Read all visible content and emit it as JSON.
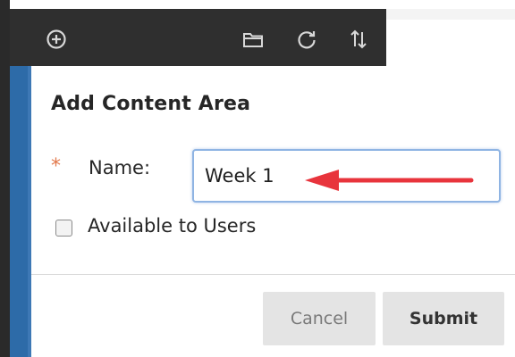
{
  "toolbar": {
    "icons": [
      "add-circle-icon",
      "folder-icon",
      "refresh-icon",
      "sort-icon"
    ]
  },
  "dialog": {
    "title": "Add Content Area",
    "required_marker": "*",
    "name_label": "Name:",
    "name_value": "Week 1",
    "available_label": "Available to Users",
    "available_checked": false,
    "cancel_label": "Cancel",
    "submit_label": "Submit"
  },
  "colors": {
    "toolbar_bg": "#2f2f2f",
    "side_stripe": "#2d6ba8",
    "required_star": "#e2784b",
    "annotation_arrow": "#e8343c",
    "input_border": "#8fb4e3"
  }
}
